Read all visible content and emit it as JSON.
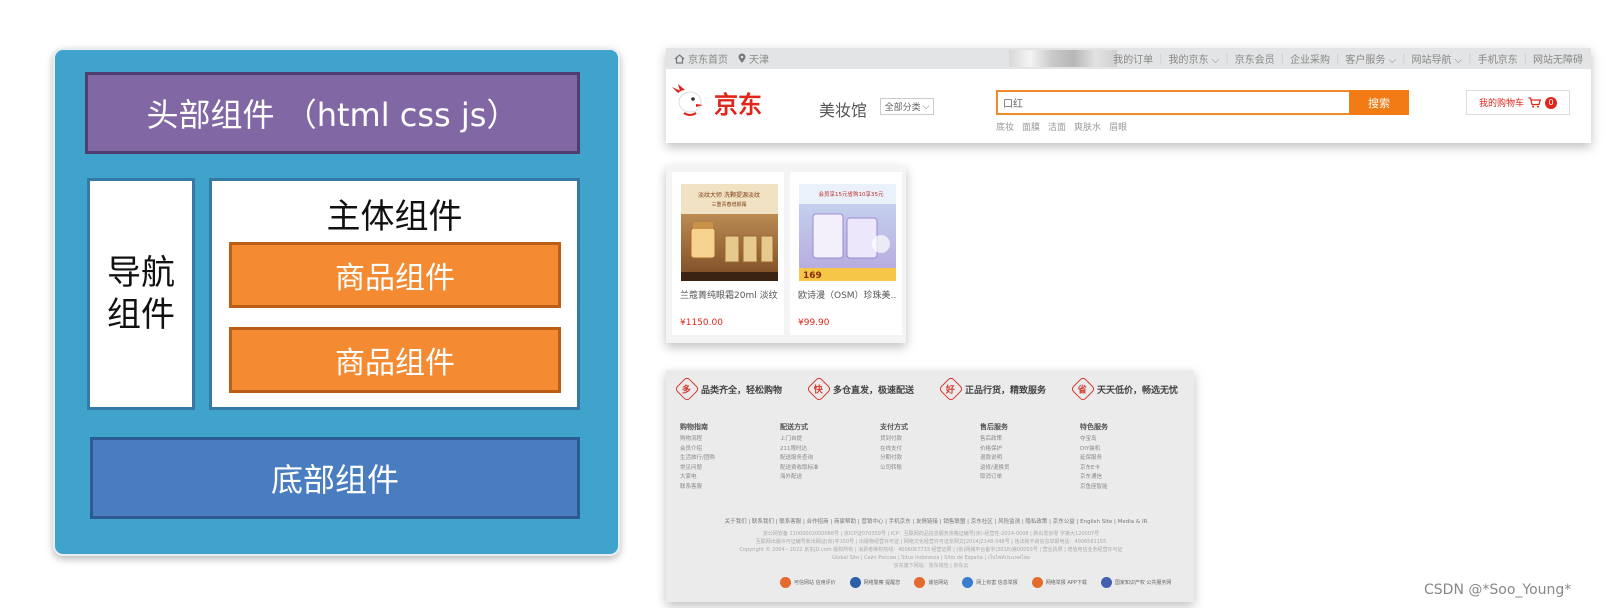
{
  "diagram": {
    "header": "头部组件 （html css js）",
    "nav_line1": "导航",
    "nav_line2": "组件",
    "main_title": "主体组件",
    "product1": "商品组件",
    "product2": "商品组件",
    "footer": "底部组件"
  },
  "jd_header": {
    "home_link": "京东首页",
    "location": "天津",
    "right_links": [
      "我的订单",
      "我的京东 ⌵",
      "京东会员",
      "企业采购",
      "客户服务 ⌵",
      "网站导航 ⌵",
      "手机京东",
      "网站无障碍"
    ],
    "logo_text": "京东",
    "category_title": "美妆馆",
    "category_select": "全部分类",
    "search_value": "口红",
    "search_button": "搜索",
    "hotwords": [
      "底妆",
      "面膜",
      "洁面",
      "爽肤水",
      "眉眼"
    ],
    "cart_label": "我的购物车",
    "cart_count": "0"
  },
  "products": [
    {
      "title": "兰蔻菁纯眼霜20ml 淡纹...",
      "price": "¥1150.00",
      "img_line1": "淡纹大师 洗颗提源淡纹",
      "img_line2": "三重青春增颜霜"
    },
    {
      "title": "欧诗漫（OSM）珍珠美...",
      "price": "¥99.90",
      "img_line1": "会员享15元省购10享35元",
      "img_price": "169"
    }
  ],
  "jd_footer": {
    "services": [
      {
        "icon": "多",
        "text": "品类齐全，轻松购物"
      },
      {
        "icon": "快",
        "text": "多仓直发，极速配送"
      },
      {
        "icon": "好",
        "text": "正品行货，精致服务"
      },
      {
        "icon": "省",
        "text": "天天低价，畅选无忧"
      }
    ],
    "help_columns": [
      {
        "title": "购物指南",
        "items": [
          "购物流程",
          "会员介绍",
          "生活旅行/团购",
          "常见问题",
          "大家电",
          "联系客服"
        ]
      },
      {
        "title": "配送方式",
        "items": [
          "上门自提",
          "211限时达",
          "配送服务查询",
          "配送费收取标准",
          "海外配送"
        ]
      },
      {
        "title": "支付方式",
        "items": [
          "货到付款",
          "在线支付",
          "分期付款",
          "公司转账"
        ]
      },
      {
        "title": "售后服务",
        "items": [
          "售后政策",
          "价格保护",
          "退款说明",
          "返修/退换货",
          "取消订单"
        ]
      },
      {
        "title": "特色服务",
        "items": [
          "夺宝岛",
          "DIY装机",
          "延保服务",
          "京东E卡",
          "京东通信",
          "京鱼座智能"
        ]
      }
    ],
    "links_line": "关于我们 | 联系我们 | 联系客服 | 合作招商 | 商家帮助 | 营销中心 | 手机京东 | 友情链接 | 销售联盟 | 京东社区 | 风险监测 | 隐私政策 | 京东公益 | English Site | Media & IR",
    "copy_lines": [
      "京公网安备 11000002000088号 | 京ICP证070359号 | ICP：互联网药品信息服务资格证编号(京)-经营性-2014-0008 | 新出发京零 字第大120007号",
      "互联网出版许可证编号新出网证(京)字150号 | 出版物经营许可证 | 网络文化经营许可证京网文[2014]2148-348号 | 违法和不良信息举报电话：4006561155",
      "Copyright © 2004 - 2022  京东JD.com 版权所有 | 消费者维权热线：4006067733  经营证照 | (京)网械平台备字(2018)第00003号 | 营业执照 | 增值电信业务经营许可证",
      "Global Site  |  Сайт России  |  Situs Indonesia  |  Sitio de España  |  เว็บไซต์ประเทศไทย",
      "京东旗下网站：京东钱包  |  京东云"
    ],
    "badges": [
      "可信网站 信用评价",
      "网络警察 提醒您",
      "诚信网站",
      "网上有害 信息举报",
      "网络举报 APP下载",
      "国家知识产权 公共服务网"
    ]
  },
  "watermark": "CSDN @*Soo_Young*"
}
